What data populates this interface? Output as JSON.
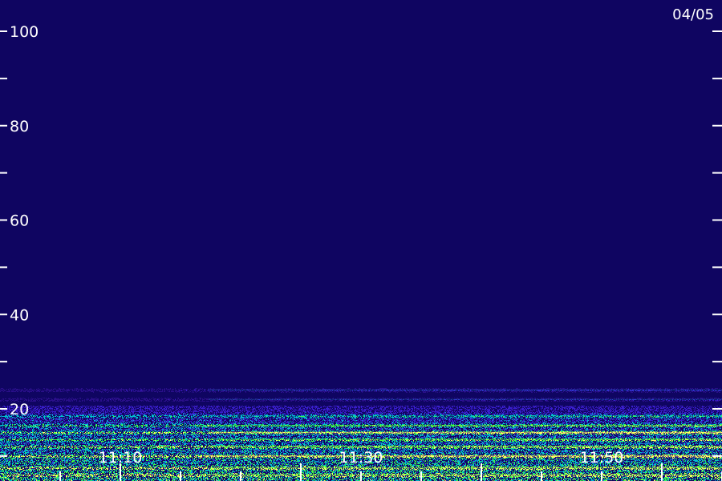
{
  "chart_data": {
    "type": "heatmap",
    "title": "",
    "xlabel": "",
    "ylabel": "",
    "date_label": "04/05",
    "y_ticks": [
      {
        "value": 10,
        "label": ""
      },
      {
        "value": 20,
        "label": "20"
      },
      {
        "value": 30,
        "label": ""
      },
      {
        "value": 40,
        "label": "40"
      },
      {
        "value": 50,
        "label": ""
      },
      {
        "value": 60,
        "label": "60"
      },
      {
        "value": 70,
        "label": ""
      },
      {
        "value": 80,
        "label": "80"
      },
      {
        "value": 90,
        "label": ""
      },
      {
        "value": 100,
        "label": "100"
      }
    ],
    "ylim": [
      5,
      105
    ],
    "x_ticks": [
      {
        "value": "11:10",
        "label": "11:10"
      },
      {
        "value": "11:30",
        "label": "11:30"
      },
      {
        "value": "11:50",
        "label": "11:50"
      }
    ],
    "minor_x_tick_count": 12,
    "background_intensity": "low",
    "bands": [
      {
        "y": 24.0,
        "intensity": 0.35
      },
      {
        "y": 22.0,
        "intensity": 0.3
      },
      {
        "y": 18.5,
        "intensity": 0.5
      },
      {
        "y": 16.5,
        "intensity": 0.75
      },
      {
        "y": 15.0,
        "intensity": 0.95
      },
      {
        "y": 13.5,
        "intensity": 0.7
      },
      {
        "y": 12.0,
        "intensity": 0.85
      },
      {
        "y": 10.0,
        "intensity": 0.9
      },
      {
        "y": 7.5,
        "intensity": 0.8
      },
      {
        "y": 6.0,
        "intensity": 0.7
      }
    ],
    "colors": {
      "background": "#2a0f8a",
      "low": "#3a1fd0",
      "mid": "#00c0d0",
      "high": "#40ff40",
      "peak": "#ffff60",
      "axis": "#ffffff"
    }
  }
}
